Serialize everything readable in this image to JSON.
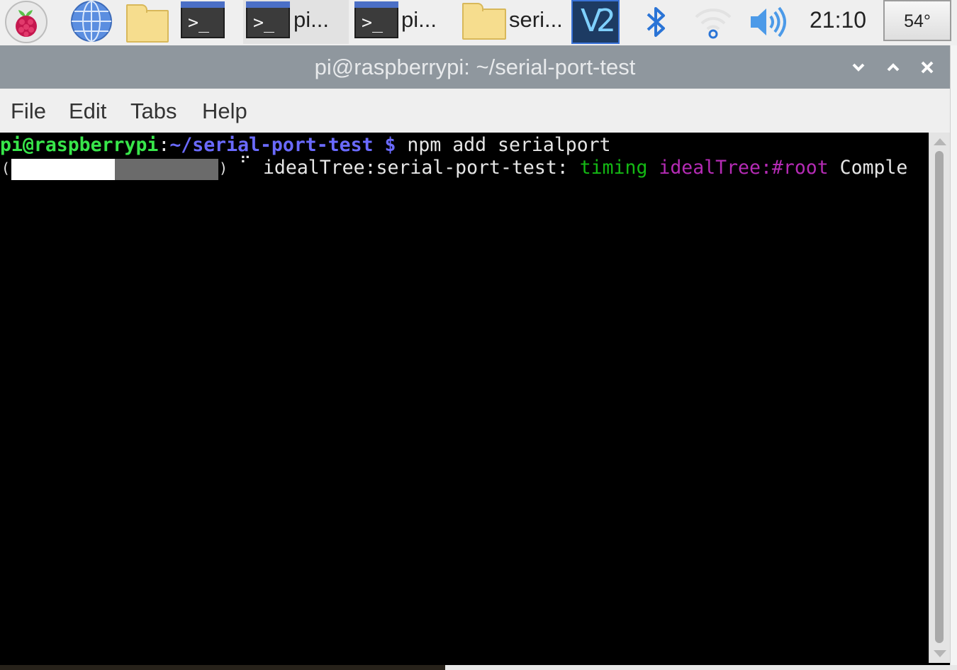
{
  "taskbar": {
    "launchers": [
      {
        "name": "raspberry-menu",
        "icon": "raspberry-pi-icon"
      },
      {
        "name": "web-browser",
        "icon": "globe-icon"
      },
      {
        "name": "file-manager",
        "icon": "folder-icon"
      },
      {
        "name": "terminal",
        "icon": "terminal-icon",
        "glyph": ">_"
      }
    ],
    "windows": [
      {
        "label": "pi...",
        "icon": "terminal-icon",
        "glyph": ">_"
      },
      {
        "label": "pi...",
        "icon": "terminal-icon",
        "glyph": ">_"
      },
      {
        "label": "seri...",
        "icon": "folder-icon"
      }
    ],
    "tray": {
      "vnc_label": "V2",
      "clock": "21:10",
      "cpu_temp": "54°"
    }
  },
  "window": {
    "title": "pi@raspberrypi: ~/serial-port-test",
    "controls": {
      "minimize": "⌄",
      "maximize": "⌃",
      "close": "✕"
    },
    "menu": [
      "File",
      "Edit",
      "Tabs",
      "Help"
    ]
  },
  "terminal": {
    "prompt_user_host": "pi@raspberrypi",
    "prompt_sep": ":",
    "prompt_path": "~/serial-port-test",
    "prompt_symbol": " $",
    "command": " npm add serialport",
    "progress_open": "(",
    "progress_close": ")",
    "progress_fraction": 0.5,
    "spinner": "⠋",
    "status_prefix": " idealTree:serial-port-test: ",
    "status_timing": "timing",
    "status_detail": " idealTree:#root",
    "status_suffix": " Comple"
  },
  "colors": {
    "prompt_green": "#38e64a",
    "prompt_blue": "#6a6aff",
    "timing_green": "#14b814",
    "detail_magenta": "#b52bb5",
    "titlebar": "#8f979e"
  }
}
